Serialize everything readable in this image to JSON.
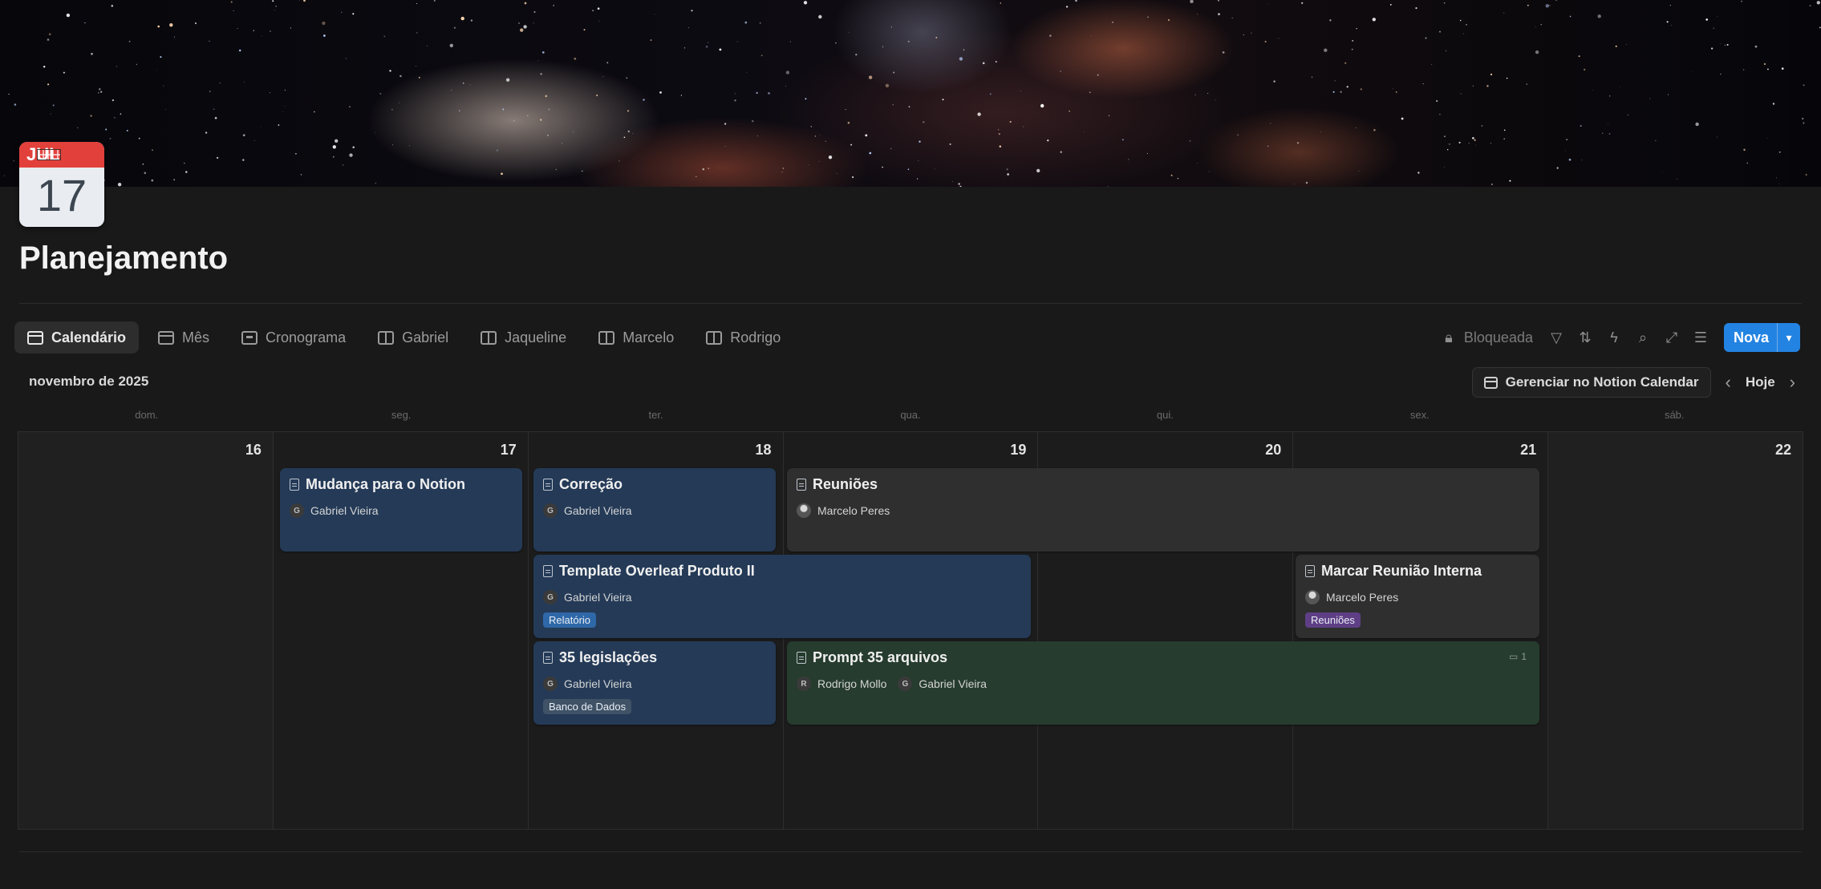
{
  "page": {
    "icon": {
      "month": "JUL",
      "day": "17"
    },
    "title": "Planejamento"
  },
  "views": {
    "tabs": [
      {
        "label": "Calendário",
        "icon": "calendar-icon",
        "active": true
      },
      {
        "label": "Mês",
        "icon": "calendar-icon",
        "active": false
      },
      {
        "label": "Cronograma",
        "icon": "timeline-icon",
        "active": false
      },
      {
        "label": "Gabriel",
        "icon": "table-icon",
        "active": false
      },
      {
        "label": "Jaqueline",
        "icon": "table-icon",
        "active": false
      },
      {
        "label": "Marcelo",
        "icon": "table-icon",
        "active": false
      },
      {
        "label": "Rodrigo",
        "icon": "table-icon",
        "active": false
      }
    ]
  },
  "toolbar": {
    "locked_label": "Bloqueada",
    "icons": [
      "filter-icon",
      "sort-icon",
      "automation-icon",
      "search-icon",
      "expand-icon",
      "settings-icon"
    ],
    "new_label": "Nova"
  },
  "calendar": {
    "month_label": "novembro de 2025",
    "manage_label": "Gerenciar no Notion Calendar",
    "today_label": "Hoje",
    "weekdays": [
      "dom.",
      "seg.",
      "ter.",
      "qua.",
      "qui.",
      "sex.",
      "sáb."
    ],
    "days": [
      "16",
      "17",
      "18",
      "19",
      "20",
      "21",
      "22"
    ]
  },
  "events": [
    {
      "title": "Mudança para o Notion",
      "people": [
        {
          "initial": "G",
          "name": "Gabriel Vieira"
        }
      ],
      "tag": null,
      "color": "blue"
    },
    {
      "title": "Correção",
      "people": [
        {
          "initial": "G",
          "name": "Gabriel Vieira"
        }
      ],
      "tag": null,
      "color": "blue"
    },
    {
      "title": "Reuniões",
      "people": [
        {
          "initial": "",
          "name": "Marcelo Peres"
        }
      ],
      "tag": null,
      "color": "gray"
    },
    {
      "title": "Template Overleaf Produto II",
      "people": [
        {
          "initial": "G",
          "name": "Gabriel Vieira"
        }
      ],
      "tag": "Relatório",
      "color": "blue"
    },
    {
      "title": "Marcar Reunião Interna",
      "people": [
        {
          "initial": "",
          "name": "Marcelo Peres"
        }
      ],
      "tag": "Reuniões",
      "color": "gray"
    },
    {
      "title": "35 legislações",
      "people": [
        {
          "initial": "G",
          "name": "Gabriel Vieira"
        }
      ],
      "tag": "Banco de Dados",
      "color": "blue"
    },
    {
      "title": "Prompt 35 arquivos",
      "people": [
        {
          "initial": "R",
          "name": "Rodrigo Mollo"
        },
        {
          "initial": "G",
          "name": "Gabriel Vieira"
        }
      ],
      "tag": null,
      "color": "green",
      "comments": "1"
    }
  ],
  "colors": {
    "accent": "#2383e2",
    "event_blue": "#243a57",
    "event_gray": "#2f2f2f",
    "event_green": "#263c2e",
    "tag_blue": "#2f68a8",
    "tag_purple": "#5e3f86",
    "tag_slate": "#3f5266"
  }
}
